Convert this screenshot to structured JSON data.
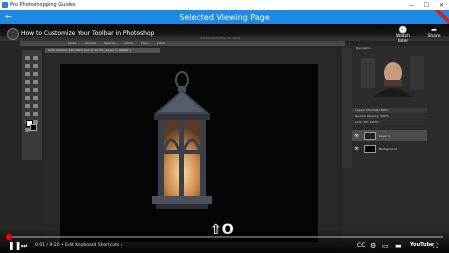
{
  "window": {
    "title": "Pro Photoshopping Guides",
    "controls": {
      "minimize": "—",
      "maximize": "☐",
      "close": "✕"
    }
  },
  "appbar": {
    "back_icon": "back-arrow-icon",
    "back_glyph": "←",
    "heading": "Selected Viewing Page"
  },
  "colors": {
    "appbar": "#1e88e5",
    "progress": "#ff0000"
  },
  "video": {
    "title": "How to Customize Your Toolbar in Photoshop",
    "watch_later": "Watch later",
    "share": "Share",
    "watch_later_glyph": "🕘",
    "share_glyph": "➦",
    "watermark": "⇧O",
    "time": "0:01 / 9:20",
    "chapter": "Edit Keyboard Shortcuts",
    "progress_fraction": 0.002,
    "controls": {
      "prev": "⏮",
      "play": "❚❚",
      "next": "⏭",
      "volume": "🔊",
      "subtitles": "CC",
      "settings": "⚙",
      "miniplayer": "▭",
      "theater": "▬",
      "fullscreen": "⛶"
    },
    "youtube_logo": "YouTube"
  },
  "photoshop": {
    "menubar": "Adobe Photoshop CC 2019",
    "options": [
      "Mode:",
      "Normal",
      "Opacity:",
      "100%",
      "Flow:",
      "100%"
    ],
    "doc_tab": "light-monitor-330-1600.psd @ 33.3% (Layer 1, RGB/8*)",
    "panels": {
      "navigator": "Navigator",
      "layers_header": "Layers  Channels  Paths",
      "blend": "Normal     Opacity: 100%",
      "lock": "Lock:     Fill: 100%",
      "layers": [
        {
          "name": "Layer 1"
        },
        {
          "name": "Background"
        }
      ]
    }
  }
}
